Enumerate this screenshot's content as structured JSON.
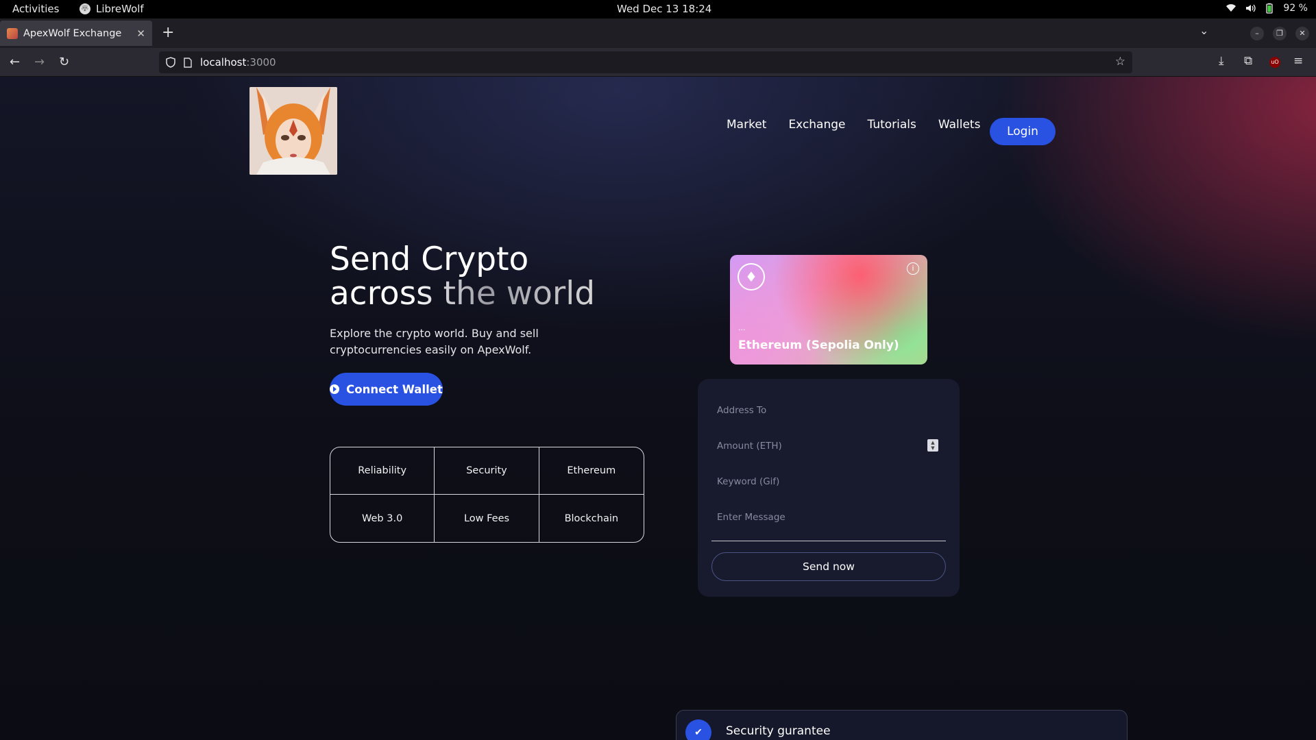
{
  "system": {
    "activities": "Activities",
    "app_name": "LibreWolf",
    "clock": "Wed Dec 13  18:24",
    "battery": "92 %"
  },
  "browser": {
    "tab_title": "ApexWolf Exchange",
    "url_host": "localhost",
    "url_port": ":3000"
  },
  "header": {
    "nav": [
      "Market",
      "Exchange",
      "Tutorials",
      "Wallets"
    ],
    "login": "Login"
  },
  "hero": {
    "title_line1": "Send Crypto",
    "title_line2": "across the world",
    "subtitle": "Explore the crypto world. Buy and sell cryptocurrencies easily on ApexWolf.",
    "connect_wallet": "Connect Wallet"
  },
  "features": [
    "Reliability",
    "Security",
    "Ethereum",
    "Web 3.0",
    "Low Fees",
    "Blockchain"
  ],
  "eth_card": {
    "address": "...",
    "network": "Ethereum (Sepolia Only)"
  },
  "form": {
    "address_placeholder": "Address To",
    "amount_placeholder": "Amount (ETH)",
    "keyword_placeholder": "Keyword (Gif)",
    "message_placeholder": "Enter Message",
    "send": "Send now"
  },
  "services": {
    "security_title": "Security gurantee"
  },
  "colors": {
    "accent": "#2952e3",
    "form_bg": "#181b2e",
    "page_bg": "#0e0f17"
  }
}
